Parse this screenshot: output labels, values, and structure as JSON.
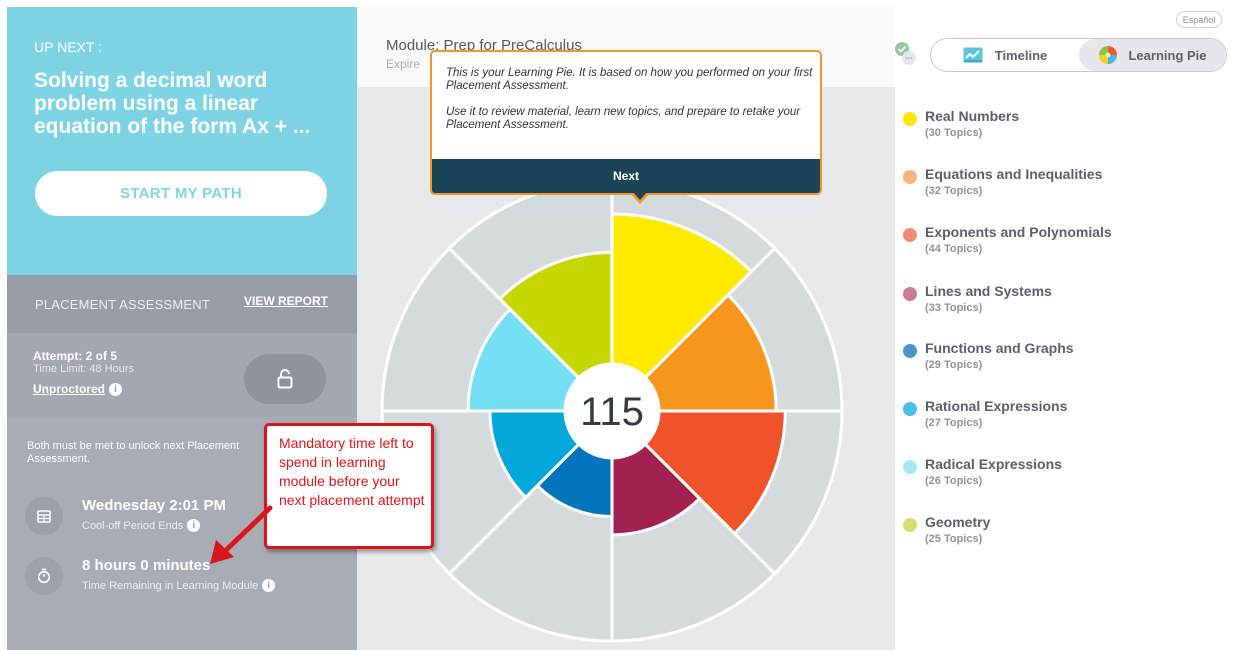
{
  "up_next": {
    "label": "UP NEXT :",
    "title": "Solving a decimal word problem using a linear equation of the form Ax + ...",
    "start_button": "START MY PATH"
  },
  "placement": {
    "title": "PLACEMENT ASSESSMENT",
    "view_report": "VIEW REPORT",
    "attempt": "Attempt: 2 of 5",
    "time_limit": "Time Limit: 48 Hours",
    "proctoring": "Unproctored"
  },
  "requirements": {
    "text": "Both must be met to unlock next Placement Assessment.",
    "cooloff_time": "Wednesday 2:01 PM",
    "cooloff_label": "Cool-off Period Ends",
    "remaining_time": "8 hours 0 minutes",
    "remaining_label": "Time Remaining in Learning Module"
  },
  "module": {
    "title": "Module: Prep for PreCalculus",
    "expires_partial": "Expire"
  },
  "tooltip": {
    "line1": "This is your Learning Pie. It is based on how you performed on your first Placement Assessment.",
    "line2": "Use it to review material, learn new topics, and prepare to retake your Placement Assessment.",
    "next_button": "Next"
  },
  "pie": {
    "score": "115"
  },
  "view_toggle": {
    "timeline": "Timeline",
    "learning_pie": "Learning Pie",
    "active": "Learning Pie"
  },
  "language": "Español",
  "legend": [
    {
      "name": "Real Numbers",
      "count": "(30 Topics)",
      "color": "#ffe500"
    },
    {
      "name": "Equations and Inequalities",
      "count": "(32 Topics)",
      "color": "#f6b478"
    },
    {
      "name": "Exponents and Polynomials",
      "count": "(44 Topics)",
      "color": "#ef8b6f"
    },
    {
      "name": "Lines and Systems",
      "count": "(33 Topics)",
      "color": "#c77c98"
    },
    {
      "name": "Functions and Graphs",
      "count": "(29 Topics)",
      "color": "#4a96cc"
    },
    {
      "name": "Rational Expressions",
      "count": "(27 Topics)",
      "color": "#4cc0e2"
    },
    {
      "name": "Radical Expressions",
      "count": "(26 Topics)",
      "color": "#a8e6f2"
    },
    {
      "name": "Geometry",
      "count": "(25 Topics)",
      "color": "#d5df6a"
    }
  ],
  "pie_progress": [
    0.82,
    0.64,
    0.69,
    0.42,
    0.32,
    0.41,
    0.53,
    0.61
  ],
  "pie_fill_colors": [
    "#ffea00",
    "#f7961e",
    "#f0532a",
    "#a1214f",
    "#0474bc",
    "#03a7d8",
    "#74dff3",
    "#c5d600"
  ],
  "annotation": {
    "text": "Mandatory time left to spend in learning module before your next placement attempt"
  }
}
